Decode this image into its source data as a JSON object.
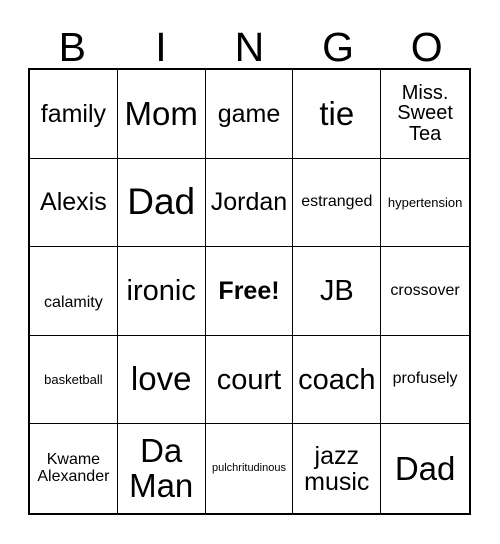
{
  "card": {
    "title": "BINGO",
    "header_letters": [
      "B",
      "I",
      "N",
      "G",
      "O"
    ],
    "rows": 5,
    "columns": 5,
    "free_space_label": "Free!",
    "free_space_position": "center",
    "colors": {
      "background": "#ffffff",
      "text": "#000000",
      "grid_line": "#000000"
    },
    "cells": [
      [
        {
          "text": "family",
          "size": "md",
          "bold": false
        },
        {
          "text": "Mom",
          "size": "xl",
          "bold": false
        },
        {
          "text": "game",
          "size": "md",
          "bold": false
        },
        {
          "text": "tie",
          "size": "xl",
          "bold": false
        },
        {
          "text": "Miss. Sweet Tea",
          "size": "sm",
          "bold": false
        }
      ],
      [
        {
          "text": "Alexis",
          "size": "md",
          "bold": false
        },
        {
          "text": "Dad",
          "size": "xxl",
          "bold": false
        },
        {
          "text": "Jordan",
          "size": "md",
          "bold": false
        },
        {
          "text": "estranged",
          "size": "xs",
          "bold": false
        },
        {
          "text": "hypertension",
          "size": "xxs",
          "bold": false
        }
      ],
      [
        {
          "text": "calamity",
          "size": "xs",
          "bold": false
        },
        {
          "text": "ironic",
          "size": "lg",
          "bold": false
        },
        {
          "text": "Free!",
          "size": "md",
          "bold": true
        },
        {
          "text": "JB",
          "size": "lg",
          "bold": false
        },
        {
          "text": "crossover",
          "size": "xs",
          "bold": false
        }
      ],
      [
        {
          "text": "basketball",
          "size": "xxs",
          "bold": false
        },
        {
          "text": "love",
          "size": "xl",
          "bold": false
        },
        {
          "text": "court",
          "size": "lg",
          "bold": false
        },
        {
          "text": "coach",
          "size": "lg",
          "bold": false
        },
        {
          "text": "profusely",
          "size": "xs",
          "bold": false
        }
      ],
      [
        {
          "text": "Kwame Alexander",
          "size": "xs",
          "bold": false
        },
        {
          "text": "Da Man",
          "size": "xl",
          "bold": false
        },
        {
          "text": "pulchritudinous",
          "size": "tiny",
          "bold": false
        },
        {
          "text": "jazz music",
          "size": "md",
          "bold": false
        },
        {
          "text": "Dad",
          "size": "xl",
          "bold": false
        }
      ]
    ]
  }
}
